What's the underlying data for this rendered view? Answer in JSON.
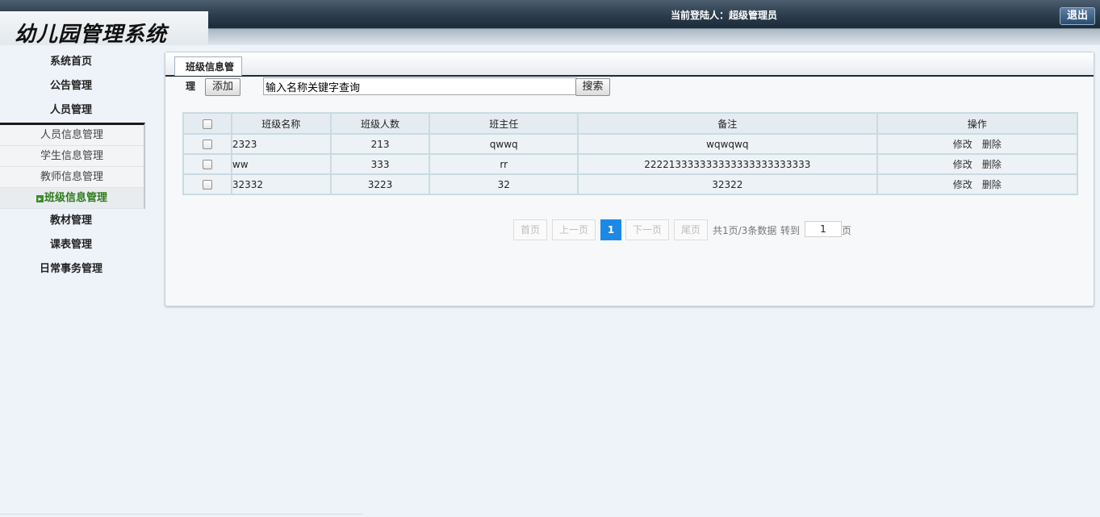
{
  "header": {
    "logo": "幼儿园管理系统",
    "login_label": "当前登陆人：",
    "login_user": "超级管理员",
    "logout": "退出"
  },
  "sidebar": {
    "items": [
      {
        "label": "系统首页"
      },
      {
        "label": "公告管理"
      },
      {
        "label": "人员管理"
      }
    ],
    "sub_items": [
      {
        "label": "人员信息管理"
      },
      {
        "label": "学生信息管理"
      },
      {
        "label": "教师信息管理"
      },
      {
        "label": "班级信息管理",
        "active": true
      }
    ],
    "items_after": [
      {
        "label": "教材管理"
      },
      {
        "label": "课表管理"
      },
      {
        "label": "日常事务管理"
      }
    ]
  },
  "main": {
    "tab": "班级信息管理",
    "add_button": "添加",
    "search_value": "输入名称关键字查询",
    "search_button": "搜索",
    "columns": [
      "班级名称",
      "班级人数",
      "班主任",
      "备注",
      "操作"
    ],
    "rows": [
      {
        "name": "2323",
        "count": "213",
        "teacher": "qwwq",
        "note": "wqwqwq"
      },
      {
        "name": "ww",
        "count": "333",
        "teacher": "rr",
        "note": "222213333333333333333333333"
      },
      {
        "name": "32332",
        "count": "3223",
        "teacher": "32",
        "note": "32322"
      }
    ],
    "edit_label": "修改",
    "delete_label": "删除"
  },
  "pagination": {
    "first": "首页",
    "prev": "上一页",
    "current": "1",
    "next": "下一页",
    "last": "尾页",
    "summary": "共1页/3条数据",
    "goto_label": "转到",
    "goto_value": "1",
    "page_suffix": "页"
  }
}
